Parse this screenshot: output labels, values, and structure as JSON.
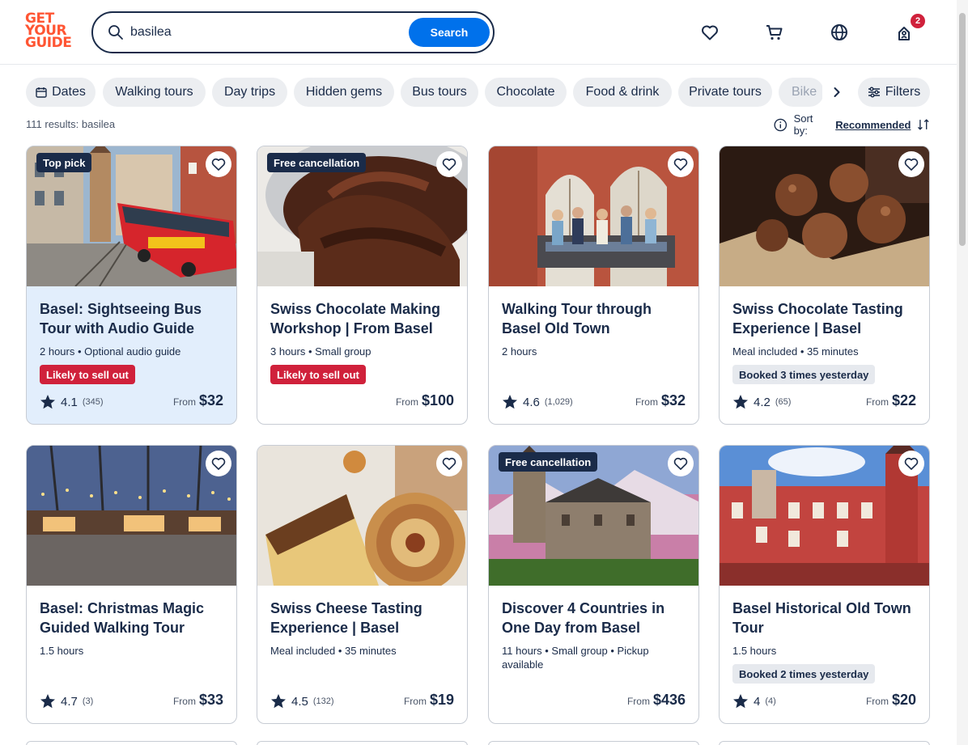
{
  "header": {
    "logo_lines": [
      "GET",
      "YOUR",
      "GUIDE"
    ],
    "search_value": "basilea",
    "search_button": "Search",
    "cart_count": "2",
    "icons": [
      "heart-icon",
      "cart-icon",
      "globe-icon",
      "profile-icon"
    ]
  },
  "filters": {
    "chips": [
      "Dates",
      "Walking tours",
      "Day trips",
      "Hidden gems",
      "Bus tours",
      "Chocolate",
      "Food & drink",
      "Private tours",
      "Bike"
    ],
    "filters_label": "Filters"
  },
  "results": {
    "count_text": "111 results: basilea",
    "sort_label": "Sort by:",
    "sort_value": "Recommended"
  },
  "cards": [
    {
      "tag": "Top pick",
      "title": "Basel: Sightseeing Bus Tour with Audio Guide",
      "meta": "2 hours • Optional audio guide",
      "pill": "Likely to sell out",
      "pill_type": "red",
      "rating": "4.1",
      "reviews": "(345)",
      "from": "From",
      "price": "$32"
    },
    {
      "tag": "Free cancellation",
      "title": "Swiss Chocolate Making Workshop | From Basel",
      "meta": "3 hours • Small group",
      "pill": "Likely to sell out",
      "pill_type": "red",
      "rating": "",
      "reviews": "",
      "from": "From",
      "price": "$100"
    },
    {
      "tag": "",
      "title": "Walking Tour through Basel Old Town",
      "meta": "2 hours",
      "pill": "",
      "pill_type": "",
      "rating": "4.6",
      "reviews": "(1,029)",
      "from": "From",
      "price": "$32"
    },
    {
      "tag": "",
      "title": "Swiss Chocolate Tasting Experience | Basel",
      "meta": "Meal included • 35 minutes",
      "pill": "Booked 3 times yesterday",
      "pill_type": "grey",
      "rating": "4.2",
      "reviews": "(65)",
      "from": "From",
      "price": "$22"
    },
    {
      "tag": "",
      "title": "Basel: Christmas Magic Guided Walking Tour",
      "meta": "1.5 hours",
      "pill": "",
      "pill_type": "",
      "rating": "4.7",
      "reviews": "(3)",
      "from": "From",
      "price": "$33"
    },
    {
      "tag": "",
      "title": "Swiss Cheese Tasting Experience | Basel",
      "meta": "Meal included • 35 minutes",
      "pill": "",
      "pill_type": "",
      "rating": "4.5",
      "reviews": "(132)",
      "from": "From",
      "price": "$19"
    },
    {
      "tag": "Free cancellation",
      "title": "Discover 4 Countries in One Day from Basel",
      "meta": "11 hours • Small group • Pickup available",
      "pill": "",
      "pill_type": "",
      "rating": "",
      "reviews": "",
      "from": "From",
      "price": "$436"
    },
    {
      "tag": "",
      "title": "Basel Historical Old Town Tour",
      "meta": "1.5 hours",
      "pill": "Booked 2 times yesterday",
      "pill_type": "grey",
      "rating": "4",
      "reviews": "(4)",
      "from": "From",
      "price": "$20"
    }
  ],
  "colors": {
    "brand": "#ff5533",
    "accent": "#0071eb",
    "text": "#1a2b49",
    "red": "#d0213b",
    "highlight": "#e2eefc"
  }
}
